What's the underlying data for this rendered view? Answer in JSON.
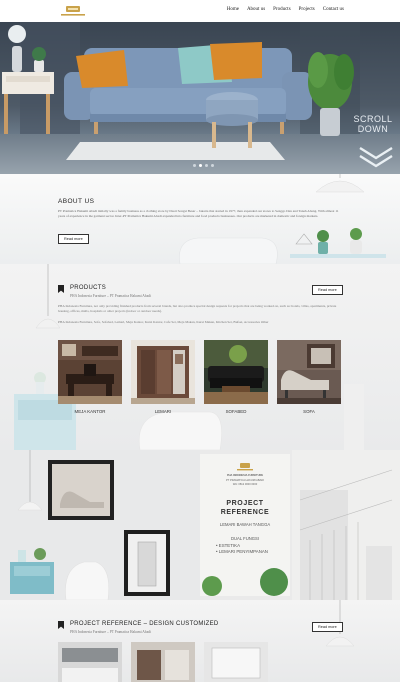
{
  "nav": {
    "items": [
      "Home",
      "About us",
      "Products",
      "Projects",
      "Contact us"
    ]
  },
  "hero": {
    "scroll_text_1": "SCROLL",
    "scroll_text_2": "DOWN"
  },
  "about": {
    "title": "ABOUT US",
    "body": "PT Pramatica Hakumi Abadi initially was a family business as a clothing store by Dasri Songsi Besar – Jakarta that started in 1977, then expanded our stores to Senggo Dan and Tanah Abang. With almost 11 years of experience in the garment sector. Inter-PT Pramatica Hakumi Abadi expanded into furniture and food products businesses. Our products are marketed in domestic and foreign markets.",
    "read_more": "Read more"
  },
  "products": {
    "title": "PRODUCTS",
    "subtitle": "PHA Indonesia Furniture – PT Pramatica Hakumi Abadi",
    "desc1": "PHA Indonesia Furniture, not only providing finished products from several brands, but also produce special design requests for projects that are being worked on, such as: hotels, villas, apartments, private housing, offices, malls, hospitals or other projects (indoor or outdoor needs).",
    "desc2": "PHA Indonesia Furniture, Sofa, Sofabed, Lemari, Meja Kantor, Kursi Kantor, Cafe Set, Meja Makan, Kursi Makan, Kitchen Set, Bufset, Accessories Other",
    "read_more": "Read more",
    "items": [
      {
        "label": "MEJA KANTOR"
      },
      {
        "label": "LEMARI"
      },
      {
        "label": "SOFABED"
      },
      {
        "label": "SOFA"
      }
    ]
  },
  "project_card": {
    "brand": "PHA INDONESIA FURNITURE",
    "line_a": "PT PRAMATICA HAKUMI ABADI",
    "line_b": "WA: 0812 0000 0000",
    "title_1": "PROJECT",
    "title_2": "REFERENCE",
    "sub_1": "LEMARI BAWAH TANGGA",
    "center": "DUAL FUNGSI",
    "bullets": [
      "ESTETIKA",
      "LEMARI PENYIMPANAN"
    ]
  },
  "design": {
    "title": "PROJECT REFERENCE – DESIGN CUSTOMIZED",
    "subtitle": "PHA Indonesia Furniture – PT Pramatica Hakumi Abadi",
    "read_more": "Read more"
  },
  "colors": {
    "accent_gold": "#c9a24a",
    "sofa_blue": "#7d97b8",
    "pillow_orange": "#d98a2b",
    "pillow_teal": "#8ec9c7"
  }
}
